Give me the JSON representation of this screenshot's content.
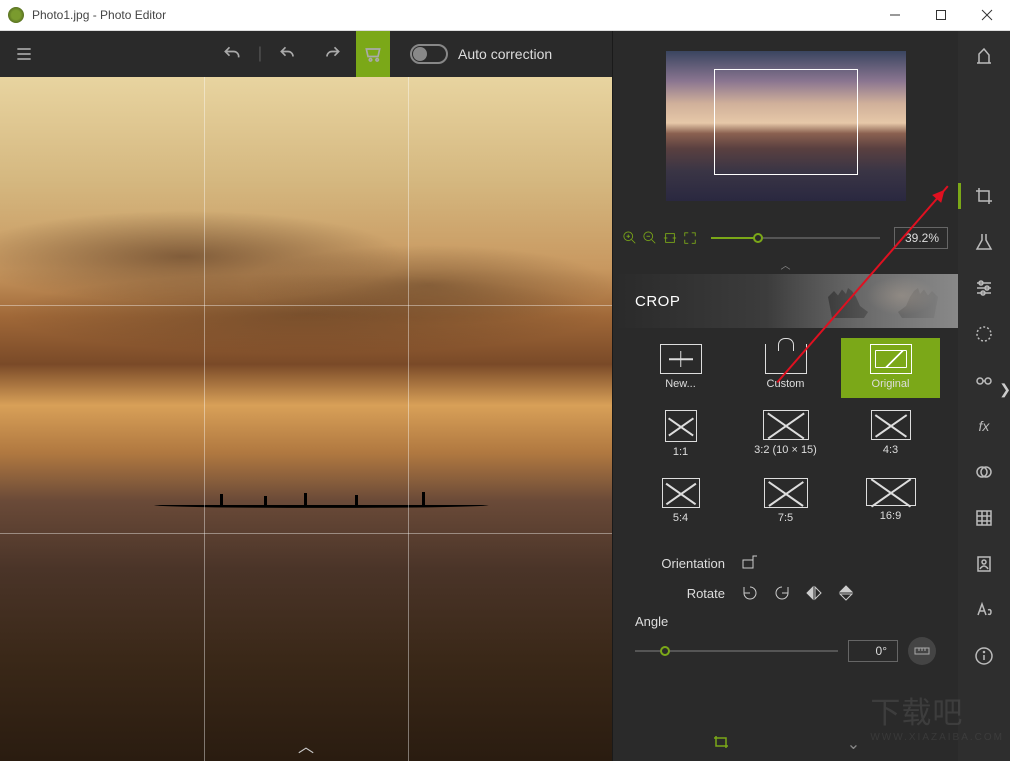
{
  "window": {
    "title": "Photo1.jpg - Photo Editor"
  },
  "toolbar": {
    "auto_correction": "Auto correction"
  },
  "zoom": {
    "value": "39.2%"
  },
  "panel": {
    "title": "CROP"
  },
  "crop": {
    "new": "New...",
    "custom": "Custom",
    "original": "Original",
    "r11": "1:1",
    "r32": "3:2 (10 × 15)",
    "r43": "4:3",
    "r54": "5:4",
    "r75": "7:5",
    "r169": "16:9"
  },
  "orient": {
    "orientation": "Orientation",
    "rotate": "Rotate",
    "angle": "Angle",
    "angle_value": "0°"
  },
  "watermark": {
    "text": "下载吧",
    "sub": "WWW.XIAZAIBA.COM"
  }
}
